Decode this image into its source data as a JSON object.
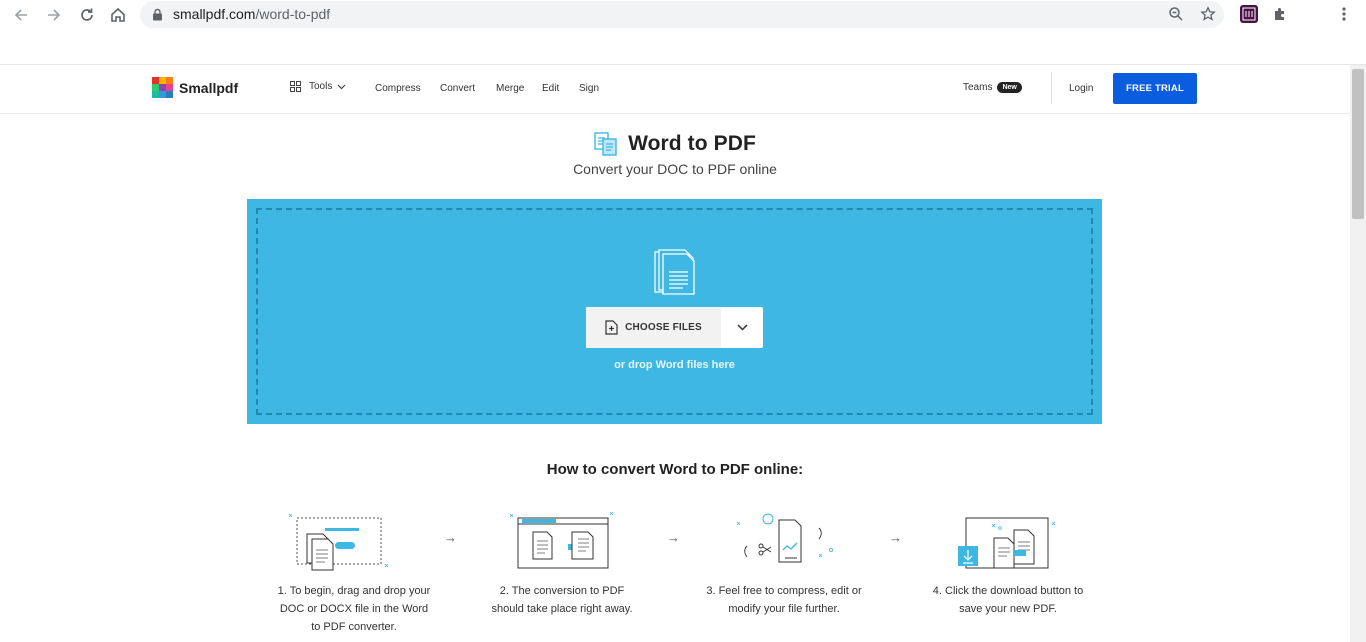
{
  "browser": {
    "url_host": "smallpdf.com",
    "url_path": "/word-to-pdf"
  },
  "header": {
    "logo_text": "Smallpdf",
    "nav": {
      "tools": "Tools",
      "compress": "Compress",
      "convert": "Convert",
      "merge": "Merge",
      "edit": "Edit",
      "sign": "Sign"
    },
    "teams_label": "Teams",
    "new_badge": "New",
    "login": "Login",
    "free_trial": "FREE TRIAL",
    "accent": "#0b5de0"
  },
  "main": {
    "title": "Word to PDF",
    "subtitle": "Convert your DOC to PDF online",
    "dropzone": {
      "choose_files": "CHOOSE FILES",
      "hint": "or drop Word files here",
      "bg_color": "#3fb7e3"
    },
    "howto_title": "How to convert Word to PDF online:",
    "steps": [
      {
        "line1": "1. To begin, drag and drop your",
        "line2": "DOC or DOCX file in the Word",
        "line3": "to PDF converter."
      },
      {
        "line1": "2. The conversion to PDF",
        "line2": "should take place right away.",
        "line3": ""
      },
      {
        "line1": "3. Feel free to compress, edit or",
        "line2": "modify your file further.",
        "line3": ""
      },
      {
        "line1": "4. Click the download button to",
        "line2": "save your new PDF.",
        "line3": ""
      }
    ]
  }
}
